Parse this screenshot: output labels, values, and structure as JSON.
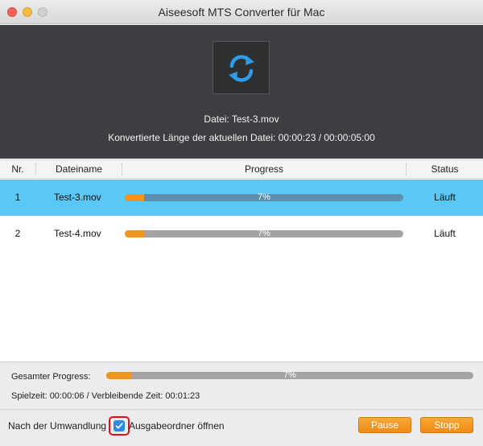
{
  "window": {
    "title": "Aiseesoft MTS Converter für Mac"
  },
  "current": {
    "file_line": "Datei: Test-3.mov",
    "length_line": "Konvertierte Länge der aktuellen Datei: 00:00:23 / 00:00:05:00"
  },
  "table": {
    "headers": {
      "nr": "Nr.",
      "name": "Dateiname",
      "progress": "Progress",
      "status": "Status"
    },
    "rows": [
      {
        "nr": "1",
        "name": "Test-3.mov",
        "progress": 7,
        "progress_label": "7%",
        "status": "Läuft"
      },
      {
        "nr": "2",
        "name": "Test-4.mov",
        "progress": 7,
        "progress_label": "7%",
        "status": "Läuft"
      }
    ]
  },
  "overall": {
    "label": "Gesamter Progress:",
    "progress": 7,
    "progress_label": "7%",
    "time_line": "Spielzeit: 00:00:06 / Verbleibende Zeit: 00:01:23"
  },
  "after": {
    "label": "Nach der Umwandlung",
    "checkbox_checked": true,
    "open_label": "Ausgabeordner öffnen"
  },
  "buttons": {
    "pause": "Pause",
    "stop": "Stopp"
  },
  "colors": {
    "accent": "#f39321",
    "selected_row": "#5ac8f5",
    "checkbox": "#2b8ae6"
  }
}
